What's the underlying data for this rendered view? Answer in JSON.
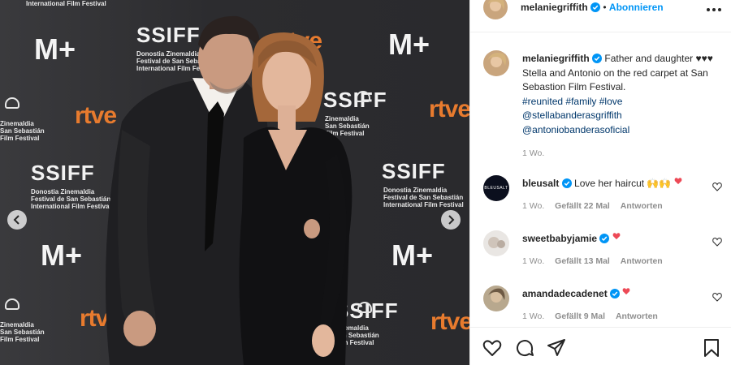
{
  "photo": {
    "wall": {
      "ssiff": "SSIFF",
      "ssiff_sub": "Donostia Zinemaldia\nFestival de San Sebastián\nInternational Film Festival",
      "rtve": "rtve",
      "mplus": "M+",
      "top_fragment": "International Film Festival",
      "fragment_zinemaldia": "Zinemaldia\nSan Sebastián\nFilm Festival",
      "fragment_film_festival": "Zinemaldia\nSan Sebastián\nFilm Festival"
    },
    "prev_arrow": "chevron-left",
    "next_arrow": "chevron-right"
  },
  "header": {
    "username": "melaniegriffith",
    "separator": "•",
    "follow_label": "Abonnieren"
  },
  "caption": {
    "username": "melaniegriffith",
    "text_before": "Father and daughter ♥♥♥ Stella and Antonio on the red carpet at San Sebastion Film Festival.",
    "tags": [
      "#reunited",
      "#family",
      "#love"
    ],
    "mentions": [
      "@stellabanderasgriffith",
      "@antoniobanderasoficial"
    ],
    "age": "1 Wo."
  },
  "comments": [
    {
      "username": "bleusalt",
      "text": "Love her haircut 🙌🙌",
      "age": "1 Wo.",
      "likes": "Gefällt 22 Mal",
      "reply": "Antworten"
    },
    {
      "username": "sweetbabyjamie",
      "text": "",
      "age": "1 Wo.",
      "likes": "Gefällt 13 Mal",
      "reply": "Antworten"
    },
    {
      "username": "amandadecadenet",
      "text": "",
      "age": "1 Wo.",
      "likes": "Gefällt 9 Mal",
      "reply": "Antworten"
    }
  ],
  "actions": [
    "heart-icon",
    "comment-icon",
    "share-icon",
    "bookmark-icon"
  ],
  "colors": {
    "accent": "#0095f6",
    "verified": "#0095f6",
    "link": "#00376b",
    "meta": "#8e8e8e",
    "heart_red": "#ed4956",
    "rtve_orange": "#e87b2e"
  }
}
